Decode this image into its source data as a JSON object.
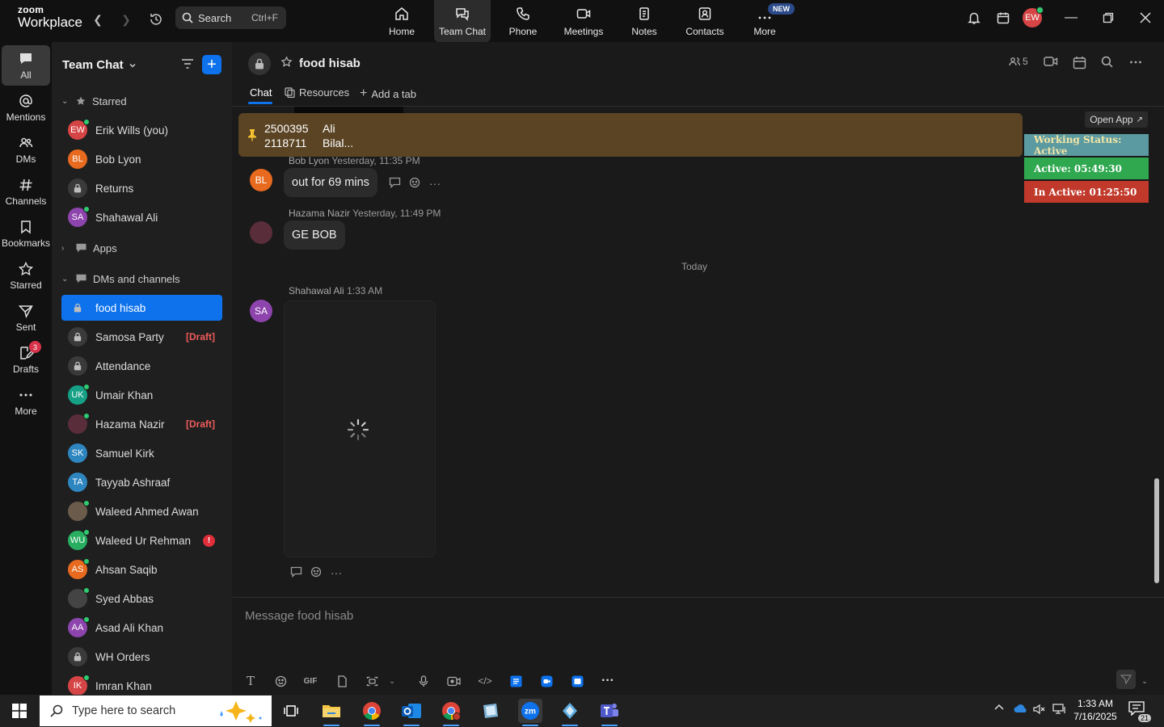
{
  "app": {
    "logo_line1": "zoom",
    "logo_line2": "Workplace",
    "search_label": "Search",
    "search_shortcut": "Ctrl+F",
    "nav": [
      {
        "label": "Home",
        "icon": "home-icon"
      },
      {
        "label": "Team Chat",
        "icon": "chat-icon",
        "active": true
      },
      {
        "label": "Phone",
        "icon": "phone-icon"
      },
      {
        "label": "Meetings",
        "icon": "video-icon"
      },
      {
        "label": "Notes",
        "icon": "notes-icon"
      },
      {
        "label": "Contacts",
        "icon": "contacts-icon"
      },
      {
        "label": "More",
        "icon": "more-icon",
        "badge": "NEW"
      }
    ],
    "user_initials": "EW",
    "accent": "#0e72ed"
  },
  "rail": [
    {
      "label": "All",
      "icon": "chat-bubble-icon",
      "active": true
    },
    {
      "label": "Mentions",
      "icon": "at-icon"
    },
    {
      "label": "DMs",
      "icon": "people-icon"
    },
    {
      "label": "Channels",
      "icon": "hash-icon"
    },
    {
      "label": "Bookmarks",
      "icon": "bookmark-icon"
    },
    {
      "label": "Starred",
      "icon": "star-icon"
    },
    {
      "label": "Sent",
      "icon": "send-icon"
    },
    {
      "label": "Drafts",
      "icon": "draft-icon",
      "badge": "3"
    },
    {
      "label": "More",
      "icon": "ellipsis-icon"
    }
  ],
  "sidebar": {
    "title": "Team Chat",
    "sections": {
      "starred": "Starred",
      "apps": "Apps",
      "dms": "DMs and channels"
    },
    "starred": [
      {
        "name": "Erik Wills (you)",
        "initials": "EW",
        "color": "#d64545",
        "online": true
      },
      {
        "name": "Bob Lyon",
        "initials": "BL",
        "color": "#e86a1f",
        "online": false
      },
      {
        "name": "Returns",
        "lock": true
      },
      {
        "name": "Shahawal Ali",
        "initials": "SA",
        "color": "#8e44ad",
        "online": true
      }
    ],
    "dms": [
      {
        "name": "food hisab",
        "lock": true,
        "active": true
      },
      {
        "name": "Samosa Party",
        "lock": true,
        "tag": "[Draft]"
      },
      {
        "name": "Attendance",
        "lock": true
      },
      {
        "name": "Umair Khan",
        "initials": "UK",
        "color": "#16a085",
        "online": true
      },
      {
        "name": "Hazama Nazir",
        "initials": "",
        "color": "#5a2d3a",
        "online": true,
        "tag": "[Draft]"
      },
      {
        "name": "Samuel Kirk",
        "initials": "SK",
        "color": "#2e86c1",
        "online": false
      },
      {
        "name": "Tayyab Ashraaf",
        "initials": "TA",
        "color": "#2e86c1",
        "online": false
      },
      {
        "name": "Waleed Ahmed Awan",
        "initials": "",
        "color": "#6b5b4b",
        "online": true
      },
      {
        "name": "Waleed Ur Rehman",
        "initials": "WU",
        "color": "#27ae60",
        "online": true,
        "alert": "!"
      },
      {
        "name": "Ahsan Saqib",
        "initials": "AS",
        "color": "#e86a1f",
        "online": true
      },
      {
        "name": "Syed Abbas",
        "initials": "",
        "color": "#444444",
        "online": true
      },
      {
        "name": "Asad Ali Khan",
        "initials": "AA",
        "color": "#8e44ad",
        "online": true
      },
      {
        "name": "WH Orders",
        "lock": true
      },
      {
        "name": "Imran Khan",
        "initials": "IK",
        "color": "#d64545",
        "online": true
      }
    ]
  },
  "channel": {
    "name": "food hisab",
    "members": "5",
    "tabs": [
      "Chat",
      "Resources",
      "Add a tab"
    ],
    "pinned": {
      "col1": [
        "2500395",
        "2118711"
      ],
      "col2": [
        "Ali",
        "Bilal..."
      ]
    },
    "messages": [
      {
        "author": "Bob Lyon",
        "time": "Yesterday, 11:35 PM",
        "text": "out for 69 mins",
        "initials": "BL",
        "color": "#e86a1f"
      },
      {
        "author": "Hazama Nazir",
        "time": "Yesterday, 11:49 PM",
        "text": "GE BOB",
        "initials": "",
        "color": "#5a2d3a"
      },
      {
        "author": "Shahawal Ali",
        "time": "1:33 AM",
        "text": "",
        "initials": "SA",
        "color": "#8e44ad"
      }
    ],
    "divider": "Today",
    "composer_placeholder": "Message food hisab"
  },
  "widget": {
    "open_app": "Open App",
    "status": "Working Status: Active",
    "active": "Active: 05:49:30",
    "inactive": "In Active: 01:25:50",
    "colors": {
      "status": "#5b9aa0",
      "active": "#2fa84f",
      "inactive": "#c0392b"
    }
  },
  "taskbar": {
    "search_placeholder": "Type here to search",
    "time": "1:33 AM",
    "date": "7/16/2025",
    "notifications": "21"
  }
}
